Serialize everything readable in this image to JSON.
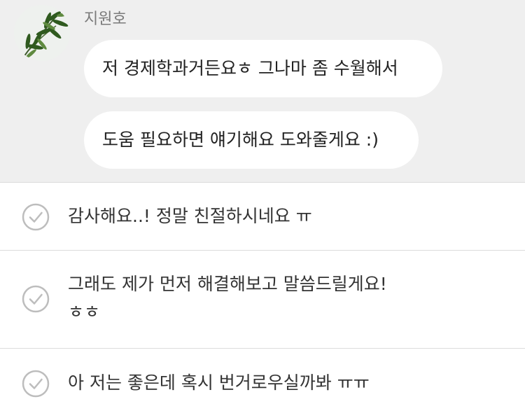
{
  "chat": {
    "sender": {
      "name": "지원호",
      "avatar_icon": "leaf-photo-avatar"
    },
    "messages": [
      "저 경제학과거든요ㅎ 그나마 좀 수월해서",
      "도움 필요하면 얘기해요 도와줄게요 :)"
    ]
  },
  "reply_options": [
    {
      "text": "감사해요..! 정말 친절하시네요 ㅠ",
      "icon": "check-circle-icon"
    },
    {
      "text": "그래도 제가 먼저 해결해보고 말씀드릴게요! ㅎㅎ",
      "icon": "check-circle-icon"
    },
    {
      "text": "아 저는 좋은데 혹시 번거로우실까봐 ㅠㅠ",
      "icon": "check-circle-icon"
    }
  ],
  "colors": {
    "chat_background": "#efefef",
    "bubble": "#ffffff",
    "divider": "#dcdcdc",
    "check_icon": "#bdbdbd"
  }
}
